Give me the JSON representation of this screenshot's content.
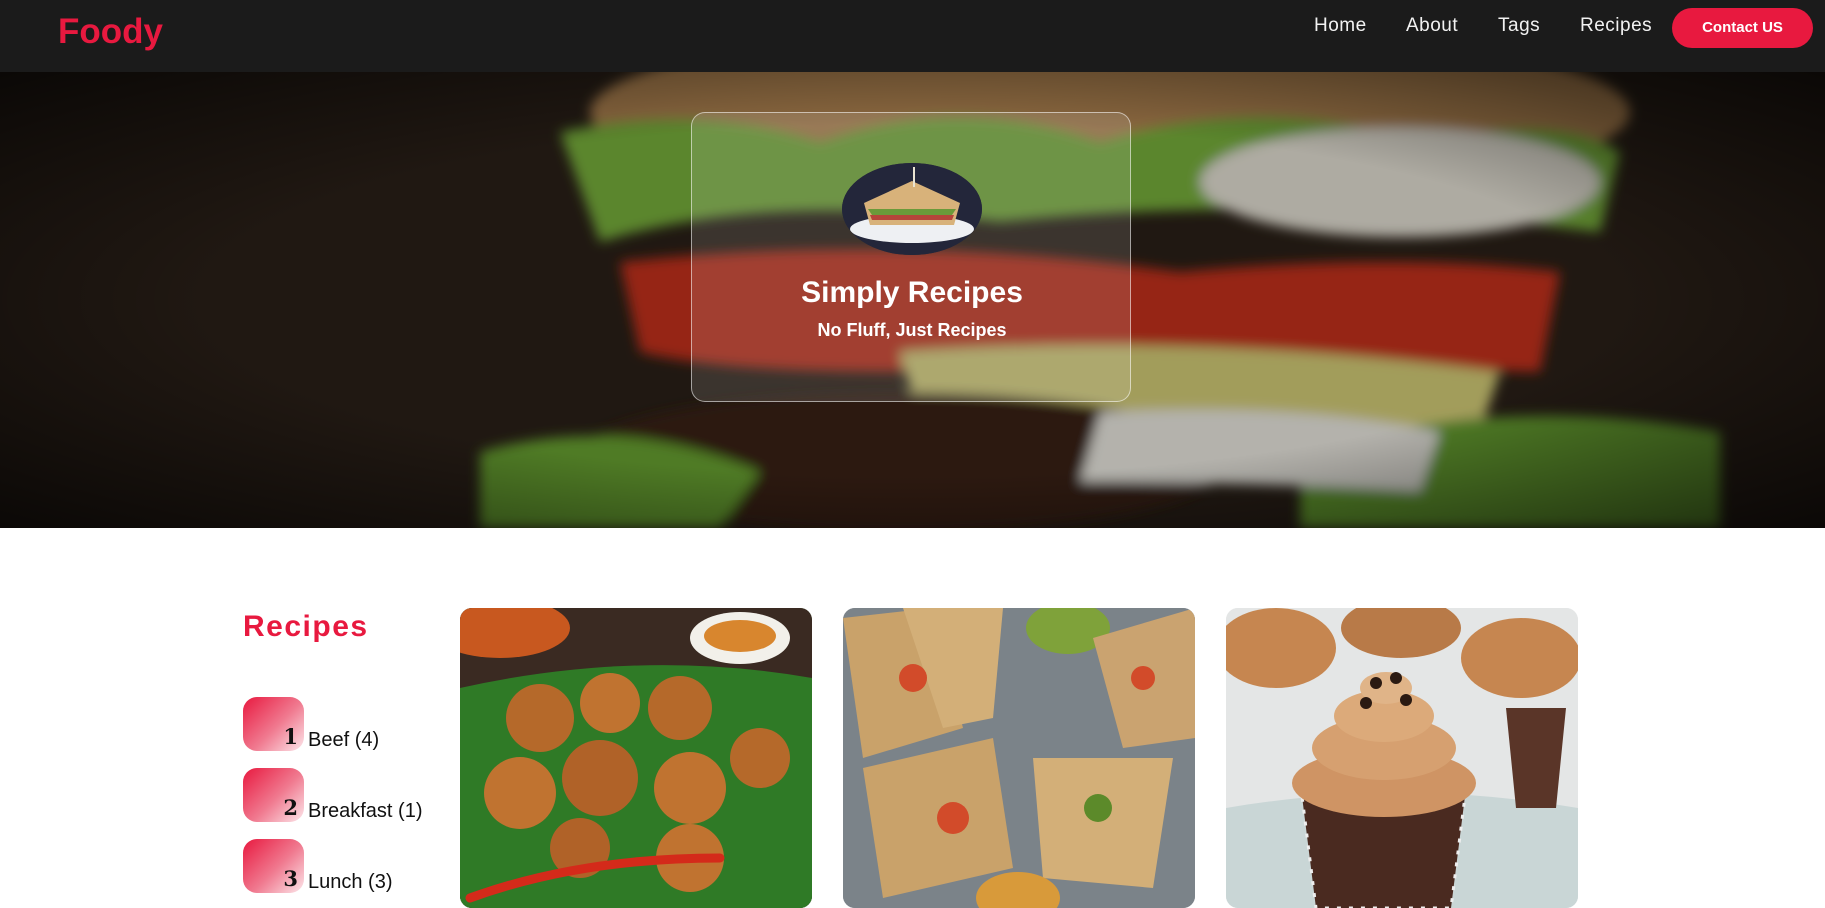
{
  "navbar": {
    "brand": "Foody",
    "links": [
      "Home",
      "About",
      "Tags",
      "Recipes"
    ],
    "contact_label": "Contact US"
  },
  "hero": {
    "title": "Simply Recipes",
    "subtitle": "No Fluff, Just Recipes"
  },
  "sidebar": {
    "title": "Recipes",
    "tags": [
      {
        "number": "1",
        "label": "Beef (4)"
      },
      {
        "number": "2",
        "label": "Breakfast (1)"
      },
      {
        "number": "3",
        "label": "Lunch (3)"
      }
    ]
  },
  "colors": {
    "accent": "#e8193f",
    "navbar_bg": "#1b1b1b"
  },
  "icons": {
    "hero_image": "burger-photo",
    "avatar": "sandwich-photo",
    "cards": [
      "fried-chicken-photo",
      "wraps-photo",
      "cupcake-photo"
    ]
  }
}
